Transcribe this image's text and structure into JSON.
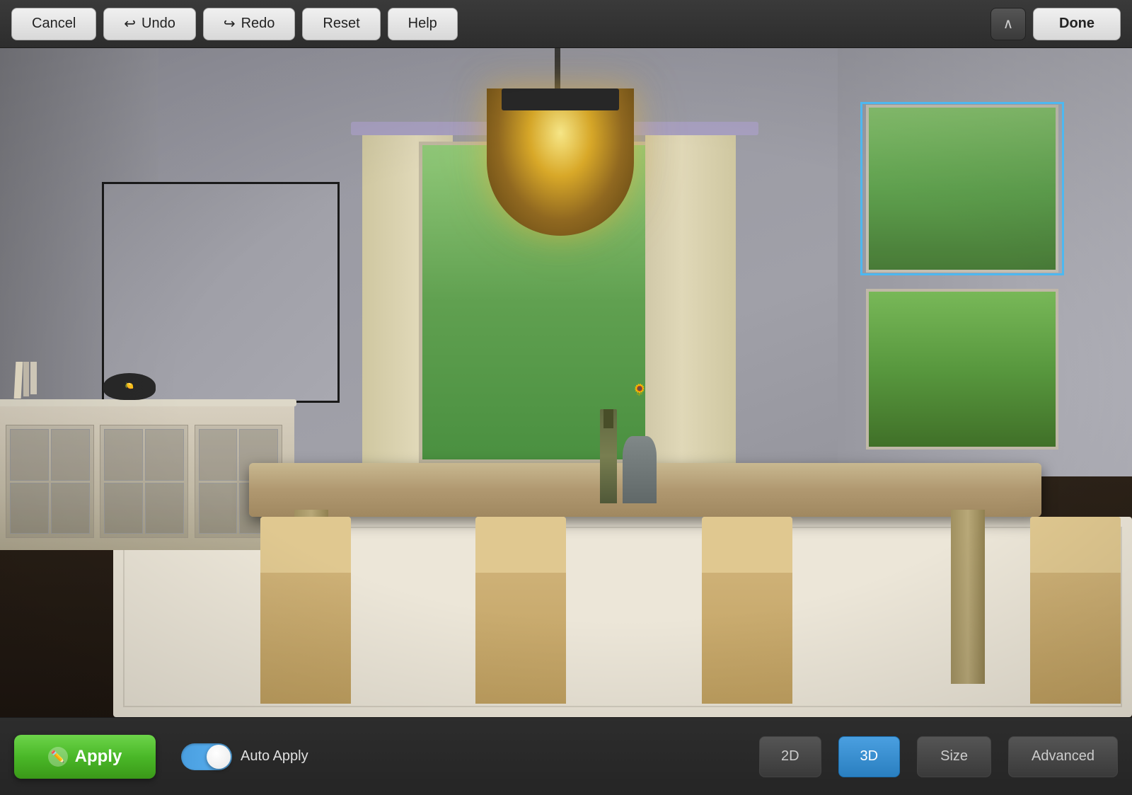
{
  "toolbar": {
    "cancel_label": "Cancel",
    "undo_label": "Undo",
    "redo_label": "Redo",
    "reset_label": "Reset",
    "help_label": "Help",
    "done_label": "Done",
    "chevron_up": "⌃"
  },
  "bottom_bar": {
    "apply_label": "Apply",
    "auto_apply_label": "Auto Apply",
    "view_2d_label": "2D",
    "view_3d_label": "3D",
    "size_label": "Size",
    "advanced_label": "Advanced",
    "toggle_on": true
  },
  "scene": {
    "selection_hint": "Selected window area"
  }
}
